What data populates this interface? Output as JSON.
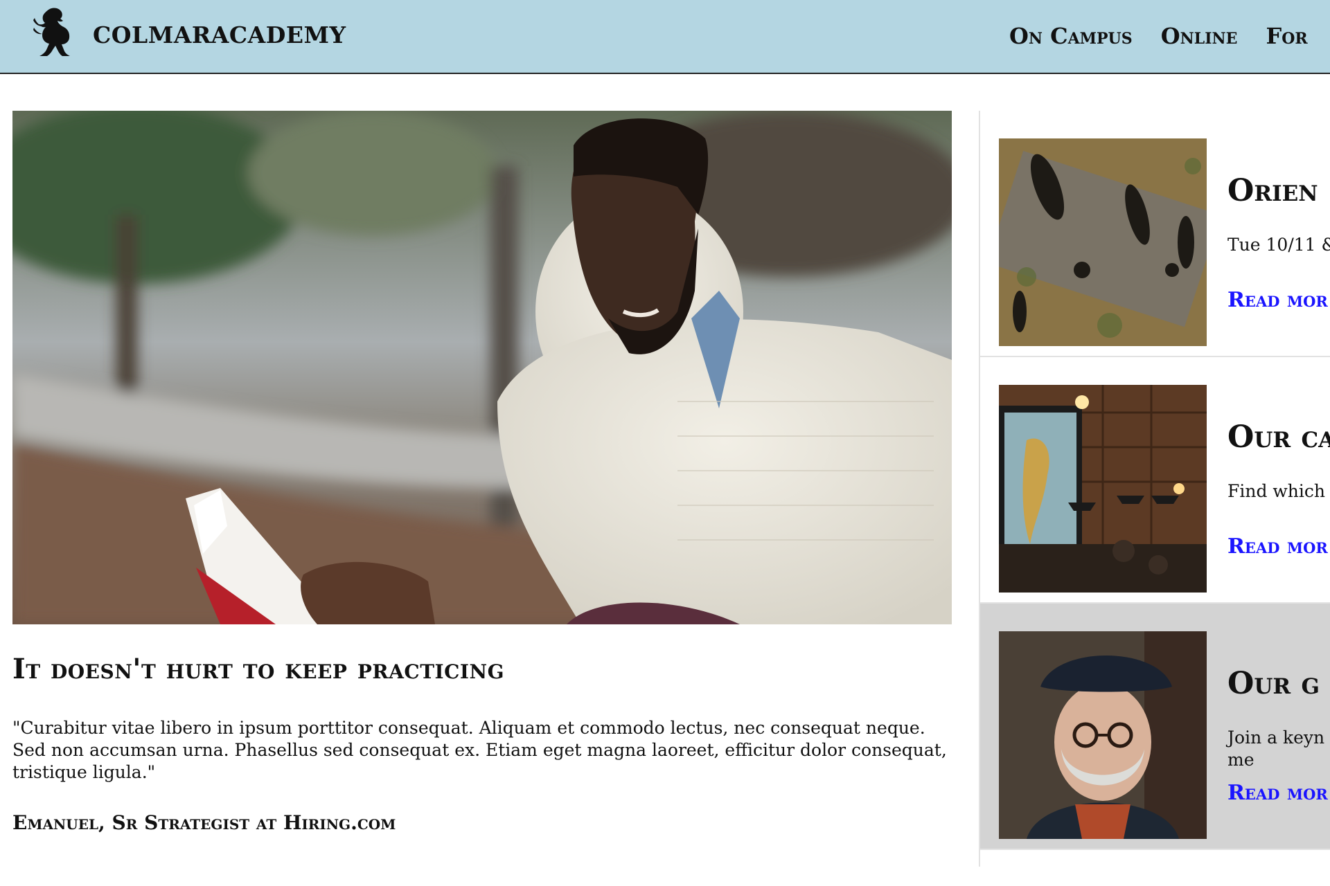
{
  "header": {
    "brand": "COLMARACADEMY",
    "logo_icon": "rearing-lion-icon",
    "nav": [
      "On Campus",
      "Online",
      "For"
    ]
  },
  "featured": {
    "image_description": "photo-student-reading-book",
    "title": "It doesn't hurt to keep practicing",
    "quote": "\"Curabitur vitae libero in ipsum porttitor consequat. Aliquam et commodo lectus, nec consequat neque. Sed non accumsan urna. Phasellus sed consequat ex. Etiam eget magna laoreet, efficitur dolor consequat, tristique ligula.\"",
    "author": "Emanuel, Sr Strategist at Hiring.com"
  },
  "sidebar": {
    "cards": [
      {
        "title": "Orien",
        "text": "Tue 10/11 &",
        "link": "Read mor",
        "thumb": "photo-people-walking-shadows"
      },
      {
        "title": "Our ca",
        "text": "Find which",
        "link": "Read mor",
        "thumb": "photo-cafe-world-map"
      },
      {
        "title": "Our g",
        "text": "Join a keyn music in me",
        "link": "Read mor",
        "thumb": "photo-man-in-beret"
      }
    ]
  },
  "colors": {
    "header_bg": "#b4d6e2",
    "link": "#1a14ff",
    "active_card_bg": "#d3d3d3"
  }
}
